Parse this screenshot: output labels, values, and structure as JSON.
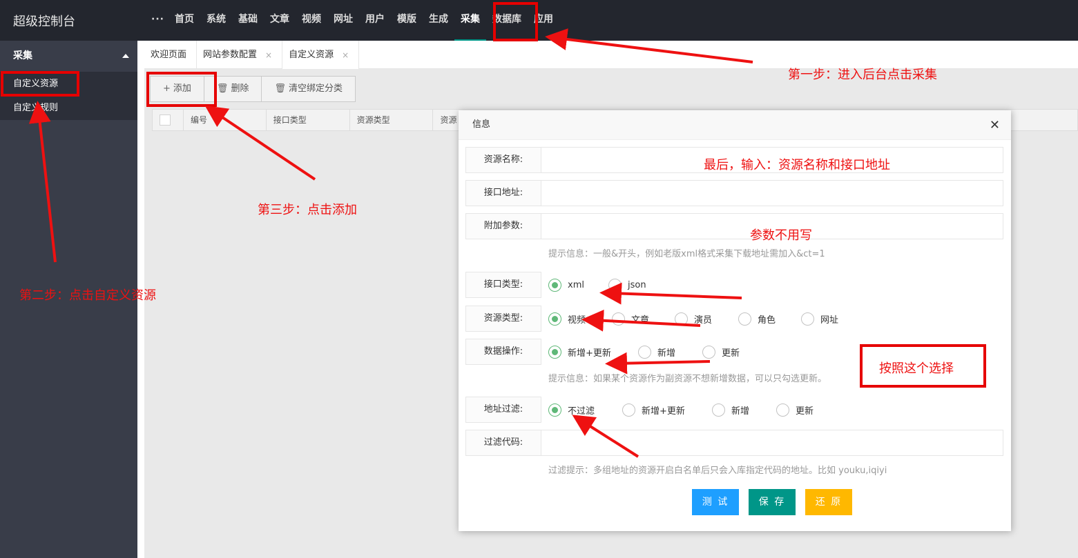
{
  "app": {
    "title": "超级控制台"
  },
  "nav": {
    "more": "···",
    "items": [
      "首页",
      "系统",
      "基础",
      "文章",
      "视频",
      "网址",
      "用户",
      "模版",
      "生成",
      "采集",
      "数据库",
      "应用"
    ]
  },
  "sidebar": {
    "section": "采集",
    "items": [
      "自定义资源",
      "自定义规则"
    ]
  },
  "tabs": [
    {
      "label": "欢迎页面"
    },
    {
      "label": "网站参数配置",
      "close": "×"
    },
    {
      "label": "自定义资源",
      "close": "×"
    }
  ],
  "toolbar": {
    "add_icon": "+",
    "add": "添加",
    "delete_icon": "🗑",
    "delete": "删除",
    "clear_icon": "🗑",
    "clear": "清空绑定分类"
  },
  "table": {
    "columns": [
      "编号",
      "接口类型",
      "资源类型",
      "资源"
    ]
  },
  "dialog": {
    "title": "信息",
    "close": "✕",
    "fields": {
      "name_label": "资源名称:",
      "url_label": "接口地址:",
      "param_label": "附加参数:",
      "param_hint": "提示信息：一般&开头，例如老版xml格式采集下载地址需加入&ct=1",
      "api_type_label": "接口类型:",
      "api_types": [
        "xml",
        "json"
      ],
      "res_type_label": "资源类型:",
      "res_types": [
        "视频",
        "文章",
        "演员",
        "角色",
        "网址"
      ],
      "data_op_label": "数据操作:",
      "data_ops": [
        "新增+更新",
        "新增",
        "更新"
      ],
      "data_op_hint": "提示信息：如果某个资源作为副资源不想新增数据，可以只勾选更新。",
      "url_filter_label": "地址过滤:",
      "url_filters": [
        "不过滤",
        "新增+更新",
        "新增",
        "更新"
      ],
      "filter_code_label": "过滤代码:",
      "filter_hint": "过滤提示：多组地址的资源开启白名单后只会入库指定代码的地址。比如 youku,iqiyi"
    },
    "buttons": {
      "test": "测 试",
      "save": "保 存",
      "reset": "还 原"
    }
  },
  "annotations": {
    "step1": "第一步：进入后台点击采集",
    "step2": "第二步：点击自定义资源",
    "step3": "第三步：点击添加",
    "last": "最后，输入：资源名称和接口地址",
    "no_param": "参数不用写",
    "choose": "按照这个选择"
  },
  "colors": {
    "header": "#23262e",
    "sidebar": "#393d49",
    "radio_checked": "#5fb878",
    "btn_test": "#1e9fff",
    "btn_save": "#009688",
    "btn_reset": "#ffb800",
    "annotation": "#ee1111"
  }
}
